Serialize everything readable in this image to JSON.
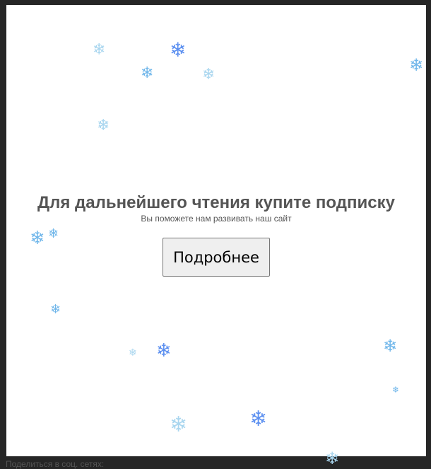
{
  "paywall": {
    "title": "Для дальнейшего чтения купите подписку",
    "subtitle": "Вы поможете нам развивать наш сайт",
    "button_label": "Подробнее"
  },
  "footer": {
    "share_text": "Поделиться в соц. сетях:"
  },
  "snowflake_glyph": "❄",
  "colors": {
    "modal_background": "#ffffff",
    "page_background": "#262626",
    "text": "#555555",
    "snowflake_light": "#a9d6ef",
    "snowflake_mid": "#6fb6ea",
    "snowflake_blue": "#5b8ff0"
  }
}
